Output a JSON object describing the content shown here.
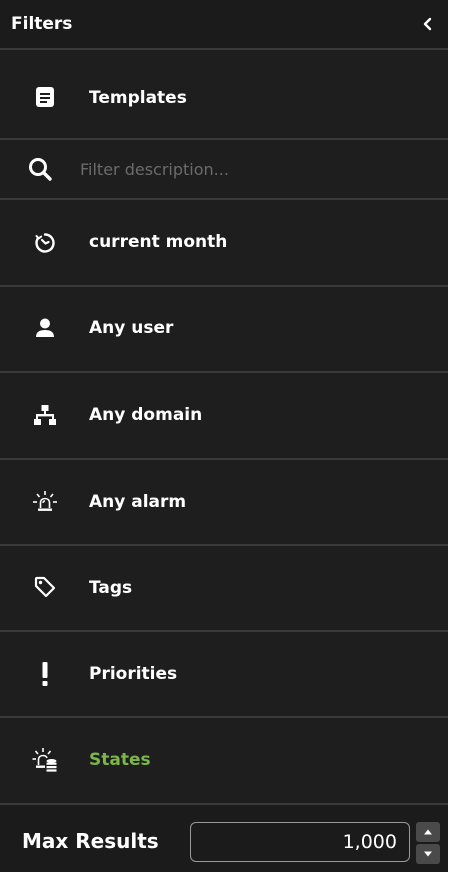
{
  "header": {
    "title": "Filters",
    "collapse_icon": "chevron-left-icon"
  },
  "templates": {
    "label": "Templates",
    "icon": "document-icon"
  },
  "search": {
    "placeholder": "Filter description...",
    "value": "",
    "icon": "search-icon"
  },
  "filters": [
    {
      "label": "current month",
      "icon": "clock-icon"
    },
    {
      "label": "Any user",
      "icon": "user-icon"
    },
    {
      "label": "Any domain",
      "icon": "hierarchy-icon"
    },
    {
      "label": "Any alarm",
      "icon": "alarm-light-icon"
    },
    {
      "label": "Tags",
      "icon": "tag-icon"
    },
    {
      "label": "Priorities",
      "icon": "exclamation-icon"
    },
    {
      "label": "States",
      "icon": "alarm-states-icon",
      "active": true
    }
  ],
  "footer": {
    "max_results_label": "Max Results",
    "max_results_value": "1,000"
  },
  "colors": {
    "background": "#1e1e1e",
    "divider": "#3a3a3a",
    "active_accent": "#7ab648",
    "placeholder": "#6b6b6b"
  }
}
